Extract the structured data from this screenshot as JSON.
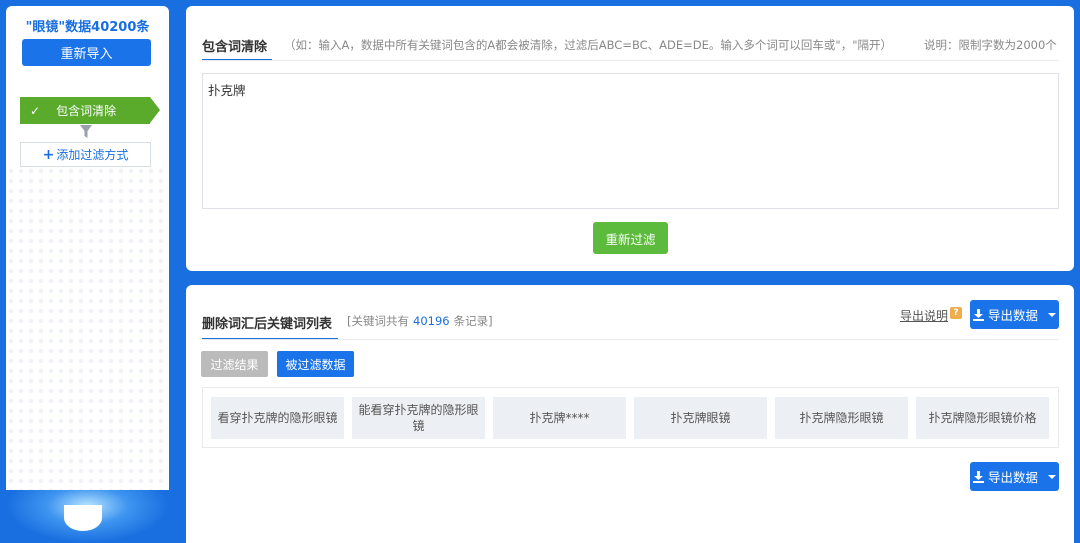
{
  "sidebar": {
    "title": "\"眼镜\"数据40200条",
    "reimport_label": "重新导入",
    "step_label": "包含词清除",
    "step_check": "✓",
    "add_filter_plus": "+",
    "add_filter_label": "添加过滤方式"
  },
  "top_panel": {
    "tab_title": "包含词清除",
    "hint": "（如：输入A，数据中所有关键词包含的A都会被清除，过滤后ABC=BC、ADE=DE。输入多个词可以回车或\"，\"隔开）",
    "note": "说明：限制字数为2000个",
    "textarea_value": "扑克牌",
    "refilter_label": "重新过滤"
  },
  "bottom_panel": {
    "tab_title": "删除词汇后关键词列表",
    "count_prefix": "[关键词共有",
    "count_value": "40196",
    "count_suffix": "条记录]",
    "export_help_label": "导出说明",
    "help_badge": "?",
    "export_label": "导出数据",
    "filter_tabs": {
      "result": "过滤结果",
      "filtered": "被过滤数据"
    },
    "keywords": [
      "看穿扑克牌的隐形眼镜",
      "能看穿扑克牌的隐形眼镜",
      "扑克牌****",
      "扑克牌眼镜",
      "扑克牌隐形眼镜",
      "扑克牌隐形眼镜价格"
    ]
  },
  "colors": {
    "background": "#1a6fe0",
    "primary": "#1a73e8",
    "success": "#5cbb3d",
    "step_green": "#5aaa2c"
  },
  "icons": {
    "download": "download-icon",
    "funnel": "funnel-icon",
    "caret": "caret-down-icon"
  }
}
